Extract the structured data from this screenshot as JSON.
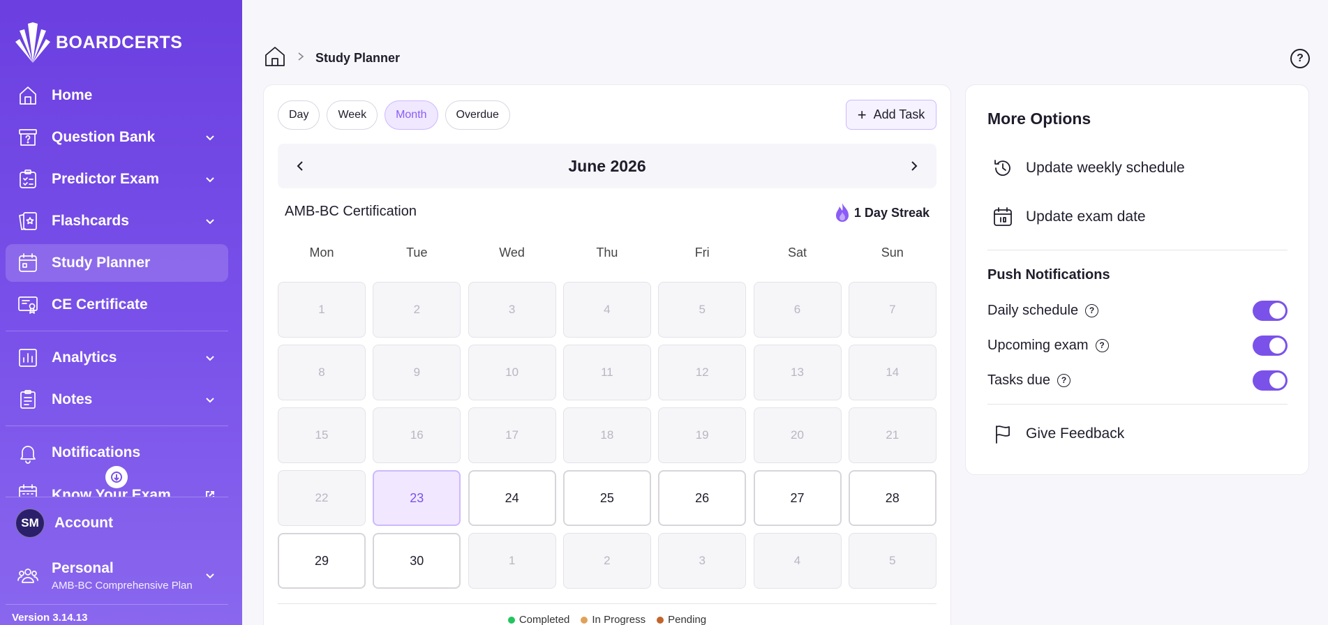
{
  "sidebar": {
    "brand": "BOARDCERTS",
    "items": [
      {
        "label": "Home",
        "icon": "home-icon",
        "chevron": false
      },
      {
        "label": "Question Bank",
        "icon": "question-bank-icon",
        "chevron": true
      },
      {
        "label": "Predictor Exam",
        "icon": "clipboard-check-icon",
        "chevron": true
      },
      {
        "label": "Flashcards",
        "icon": "flashcards-icon",
        "chevron": true
      },
      {
        "label": "Study Planner",
        "icon": "calendar-icon",
        "chevron": false,
        "active": true
      },
      {
        "label": "CE Certificate",
        "icon": "certificate-icon",
        "chevron": false
      },
      {
        "label": "Analytics",
        "icon": "analytics-icon",
        "chevron": true
      },
      {
        "label": "Notes",
        "icon": "notes-icon",
        "chevron": true
      },
      {
        "label": "Notifications",
        "icon": "bell-icon",
        "chevron": false
      },
      {
        "label": "Know Your Exam",
        "icon": "calendar-grid-icon",
        "external": true
      }
    ],
    "account": {
      "initials": "SM",
      "label": "Account"
    },
    "personal": {
      "title": "Personal",
      "plan": "AMB-BC Comprehensive Plan"
    },
    "version": "Version 3.14.13"
  },
  "header": {
    "breadcrumb_current": "Study Planner",
    "help": "?"
  },
  "calendar": {
    "view_tabs": [
      {
        "label": "Day",
        "active": false
      },
      {
        "label": "Week",
        "active": false
      },
      {
        "label": "Month",
        "active": true
      },
      {
        "label": "Overdue",
        "active": false
      }
    ],
    "add_task_label": "Add Task",
    "month_title": "June 2026",
    "certification": "AMB-BC Certification",
    "streak": "1 Day Streak",
    "weekdays": [
      "Mon",
      "Tue",
      "Wed",
      "Thu",
      "Fri",
      "Sat",
      "Sun"
    ],
    "weeks": [
      [
        {
          "d": "1",
          "s": "past"
        },
        {
          "d": "2",
          "s": "past"
        },
        {
          "d": "3",
          "s": "past"
        },
        {
          "d": "4",
          "s": "past"
        },
        {
          "d": "5",
          "s": "past"
        },
        {
          "d": "6",
          "s": "past"
        },
        {
          "d": "7",
          "s": "past"
        }
      ],
      [
        {
          "d": "8",
          "s": "past"
        },
        {
          "d": "9",
          "s": "past"
        },
        {
          "d": "10",
          "s": "past"
        },
        {
          "d": "11",
          "s": "past"
        },
        {
          "d": "12",
          "s": "past"
        },
        {
          "d": "13",
          "s": "past"
        },
        {
          "d": "14",
          "s": "past"
        }
      ],
      [
        {
          "d": "15",
          "s": "past"
        },
        {
          "d": "16",
          "s": "past"
        },
        {
          "d": "17",
          "s": "past"
        },
        {
          "d": "18",
          "s": "past"
        },
        {
          "d": "19",
          "s": "past"
        },
        {
          "d": "20",
          "s": "past"
        },
        {
          "d": "21",
          "s": "past"
        }
      ],
      [
        {
          "d": "22",
          "s": "past"
        },
        {
          "d": "23",
          "s": "today"
        },
        {
          "d": "24",
          "s": "current"
        },
        {
          "d": "25",
          "s": "current"
        },
        {
          "d": "26",
          "s": "current"
        },
        {
          "d": "27",
          "s": "current"
        },
        {
          "d": "28",
          "s": "current"
        }
      ],
      [
        {
          "d": "29",
          "s": "current"
        },
        {
          "d": "30",
          "s": "current"
        },
        {
          "d": "1",
          "s": "other"
        },
        {
          "d": "2",
          "s": "other"
        },
        {
          "d": "3",
          "s": "other"
        },
        {
          "d": "4",
          "s": "other"
        },
        {
          "d": "5",
          "s": "other"
        }
      ]
    ],
    "legend": [
      {
        "label": "Completed",
        "color": "#22c55e"
      },
      {
        "label": "In Progress",
        "color": "#e0a25a"
      },
      {
        "label": "Pending",
        "color": "#c2642b"
      }
    ]
  },
  "options": {
    "title": "More Options",
    "actions": [
      {
        "label": "Update weekly schedule",
        "icon": "history-icon"
      },
      {
        "label": "Update exam date",
        "icon": "calendar-date-icon"
      }
    ],
    "push_title": "Push Notifications",
    "push_items": [
      {
        "label": "Daily schedule",
        "on": true
      },
      {
        "label": "Upcoming exam",
        "on": true
      },
      {
        "label": "Tasks due",
        "on": true
      }
    ],
    "feedback_label": "Give Feedback"
  },
  "colors": {
    "accent": "#7a52ea",
    "sidebar_top": "#6b3fe0",
    "sidebar_bottom": "#8a67ee",
    "today_bg": "#f1e8ff"
  }
}
